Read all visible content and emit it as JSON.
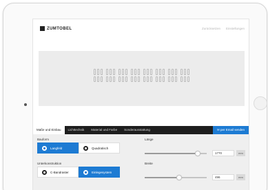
{
  "header": {
    "logo_text": "ZUMTOBEL",
    "links": [
      "Zurücksetzen",
      "Einstellungen"
    ]
  },
  "preview": {
    "modules": 8,
    "cells_per_module": 6
  },
  "tabs": [
    {
      "label": "Maße und Einbau",
      "active": true
    },
    {
      "label": "Lichttechnik",
      "active": false
    },
    {
      "label": "Material und Farbe",
      "active": false
    },
    {
      "label": "Sonderausstattung",
      "active": false
    }
  ],
  "email_button": "✉ per Email senden",
  "config": {
    "bauform": {
      "label": "Bauform",
      "options": [
        {
          "label": "Langfeld",
          "icon": "langfeld-icon",
          "selected": true
        },
        {
          "label": "Quadratisch",
          "icon": "quadratisch-icon",
          "selected": false
        }
      ]
    },
    "unterkonstruktion": {
      "label": "Unterkonstruktion",
      "options": [
        {
          "label": "C-Bandraster",
          "icon": "c-bandraster-icon",
          "selected": false
        },
        {
          "label": "Einlegesystem",
          "icon": "einlegesystem-icon",
          "selected": true
        }
      ]
    },
    "laenge": {
      "label": "Länge",
      "value": "1770",
      "unit": "mm",
      "slider_fraction": 0.85
    },
    "breite": {
      "label": "Breite",
      "value": "496",
      "unit": "mm",
      "slider_fraction": 0.55
    }
  },
  "colors": {
    "accent": "#1d7bd3",
    "tabbar": "#1e1e1e"
  }
}
